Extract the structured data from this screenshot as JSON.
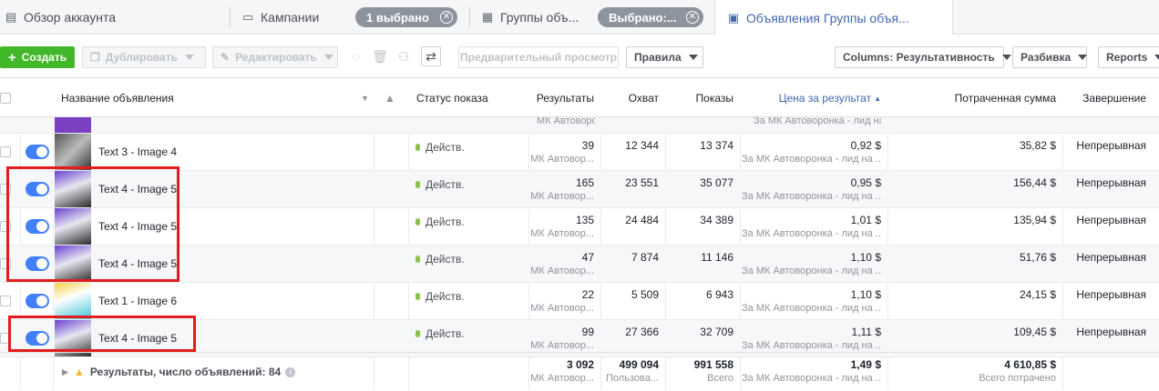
{
  "tabs": {
    "overview": "Обзор аккаунта",
    "campaigns": "Кампании",
    "campaigns_selected": "1 выбрано",
    "adsets": "Группы объ...",
    "adsets_selected": "Выбрано:...",
    "ads": "Объявления Группы объя..."
  },
  "toolbar": {
    "create": "Создать",
    "duplicate": "Дублировать",
    "edit": "Редактировать",
    "preview": "Предварительный просмотр",
    "rules": "Правила",
    "columns": "Columns: Результативность",
    "breakdown": "Разбивка",
    "reports": "Reports"
  },
  "headers": {
    "name": "Название объявления",
    "status": "Статус показа",
    "results": "Результаты",
    "reach": "Охват",
    "impressions": "Показы",
    "cost": "Цена за результат",
    "spent": "Потраченная сумма",
    "end": "Завершение"
  },
  "partial_row": {
    "sub_results": "МК Автоворонка - лид на...",
    "sub_cost": "За МК Автоворонка - лид на ..."
  },
  "rows": [
    {
      "name": "Text 3 - Image 4",
      "status": "Действ.",
      "results": "39",
      "results_sub": "МК Автовор...",
      "reach": "12 344",
      "impressions": "13 374",
      "cost": "0,92 $",
      "cost_sub": "За МК Автоворонка - лид на ...",
      "spent": "35,82 $",
      "end": "Непрерывная"
    },
    {
      "name": "Text 4 - Image 5",
      "status": "Действ.",
      "results": "165",
      "results_sub": "МК Автовор...",
      "reach": "23 551",
      "impressions": "35 077",
      "cost": "0,95 $",
      "cost_sub": "За МК Автоворонка - лид на ...",
      "spent": "156,44 $",
      "end": "Непрерывная"
    },
    {
      "name": "Text 4 - Image 5",
      "status": "Действ.",
      "results": "135",
      "results_sub": "МК Автовор...",
      "reach": "24 484",
      "impressions": "34 389",
      "cost": "1,01 $",
      "cost_sub": "За МК Автоворонка - лид на ...",
      "spent": "135,94 $",
      "end": "Непрерывная"
    },
    {
      "name": "Text 4 - Image 5",
      "status": "Действ.",
      "results": "47",
      "results_sub": "МК Автовор...",
      "reach": "7 874",
      "impressions": "11 146",
      "cost": "1,10 $",
      "cost_sub": "За МК Автоворонка - лид на ...",
      "spent": "51,76 $",
      "end": "Непрерывная"
    },
    {
      "name": "Text 1 - Image 6",
      "status": "Действ.",
      "results": "22",
      "results_sub": "МК Автовор...",
      "reach": "5 509",
      "impressions": "6 943",
      "cost": "1,10 $",
      "cost_sub": "За МК Автоворонка - лид на ...",
      "spent": "24,15 $",
      "end": "Непрерывная"
    },
    {
      "name": "Text 4 - Image 5",
      "status": "Действ.",
      "results": "99",
      "results_sub": "МК Автовор...",
      "reach": "27 366",
      "impressions": "32 709",
      "cost": "1,11 $",
      "cost_sub": "За МК Автоворонка - лид на ...",
      "spent": "109,45 $",
      "end": "Непрерывная"
    }
  ],
  "totals": {
    "label": "Результаты, число объявлений: 84",
    "results": "3 092",
    "results_sub": "МК Автовор...",
    "reach": "499 094",
    "reach_sub": "Пользова...",
    "impressions": "991 558",
    "impressions_sub": "Всего",
    "cost": "1,49 $",
    "cost_sub": "За МК Автоворонка - лид на ...",
    "spent": "4 610,85 $",
    "spent_sub": "Всего потрачено"
  },
  "colors": {
    "accent": "#4267b2",
    "toggle": "#4080ff",
    "create": "#42b72a",
    "highlight": "#e21c1c"
  }
}
